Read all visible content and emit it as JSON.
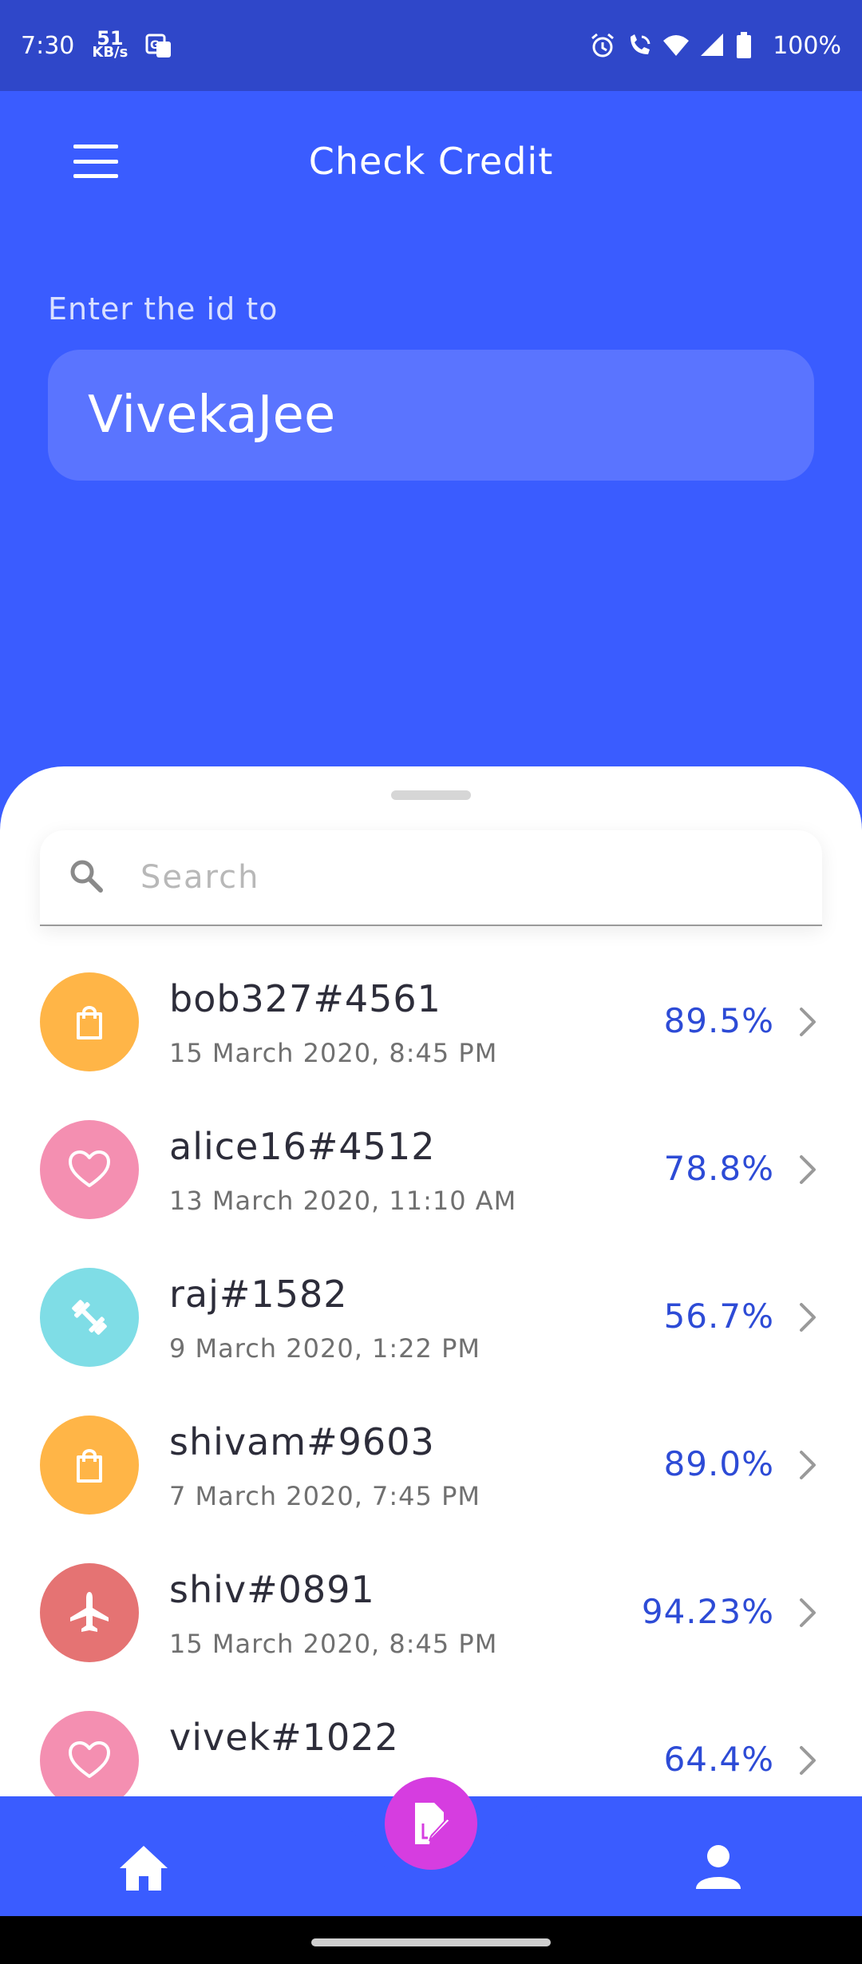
{
  "status_bar": {
    "time": "7:30",
    "net_speed_value": "51",
    "net_speed_unit": "KB/s",
    "battery": "100%",
    "icons": [
      "translate-icon",
      "alarm-icon",
      "wifi-call-icon",
      "wifi-icon",
      "signal-icon",
      "battery-icon"
    ]
  },
  "header": {
    "title": "Check Credit"
  },
  "form": {
    "label": "Enter the id to",
    "id_value": "VivekaJee"
  },
  "search": {
    "placeholder": "Search"
  },
  "transactions": [
    {
      "name": "bob327#4561",
      "date": "15 March 2020, 8:45 PM",
      "score": "89.5%",
      "icon": "shopping-bag-icon",
      "color": "#ffb547"
    },
    {
      "name": "alice16#4512",
      "date": "13 March 2020, 11:10 AM",
      "score": "78.8%",
      "icon": "heart-icon",
      "color": "#f48fb1"
    },
    {
      "name": "raj#1582",
      "date": "9 March 2020, 1:22 PM",
      "score": "56.7%",
      "icon": "dumbbell-icon",
      "color": "#7fdde6"
    },
    {
      "name": "shivam#9603",
      "date": "7 March 2020, 7:45 PM",
      "score": "89.0%",
      "icon": "shopping-bag-icon",
      "color": "#ffb547"
    },
    {
      "name": "shiv#0891",
      "date": "15 March 2020, 8:45 PM",
      "score": "94.23%",
      "icon": "airplane-icon",
      "color": "#e57373"
    },
    {
      "name": "vivek#1022",
      "date": "",
      "score": "64.4%",
      "icon": "heart-icon",
      "color": "#f48fb1"
    }
  ],
  "colors": {
    "primary": "#3a5cff",
    "status_bar": "#2f47c9",
    "fab": "#d63de0",
    "score_text": "#2d4bd6"
  },
  "nav": {
    "items": [
      "home-icon",
      "edit-document-icon",
      "person-icon"
    ]
  }
}
